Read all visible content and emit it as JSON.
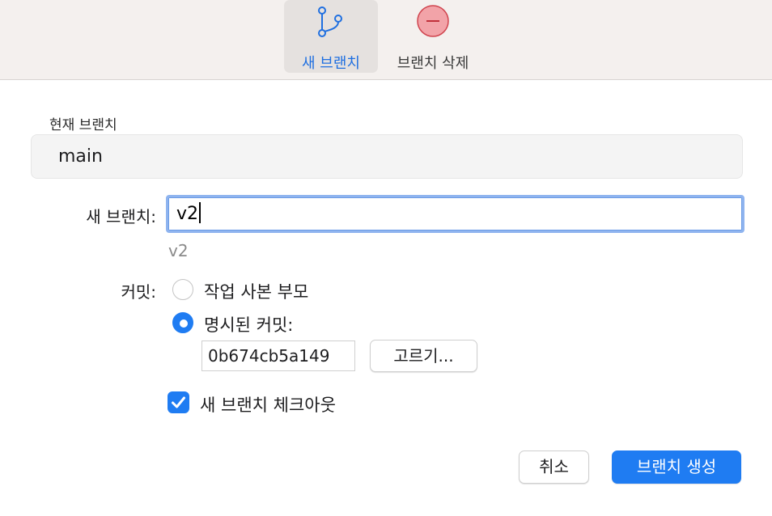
{
  "toolbar": {
    "new_branch_label": "새 브랜치",
    "delete_branch_label": "브랜치 삭제"
  },
  "current_branch": {
    "label": "현재 브랜치",
    "value": "main"
  },
  "new_branch": {
    "label": "새 브랜치:",
    "value": "v2",
    "preview": "v2"
  },
  "commit": {
    "label": "커밋:",
    "option_working_copy": "작업 사본 부모",
    "option_specified": "명시된 커밋:",
    "selected": "specified",
    "hash": "0b674cb5a149",
    "choose_label": "고르기..."
  },
  "checkout": {
    "label": "새 브랜치 체크아웃",
    "checked": true
  },
  "footer": {
    "cancel_label": "취소",
    "create_label": "브랜치 생성"
  },
  "colors": {
    "accent": "#1f7cf2",
    "delete_icon": "#f2a3a8"
  }
}
